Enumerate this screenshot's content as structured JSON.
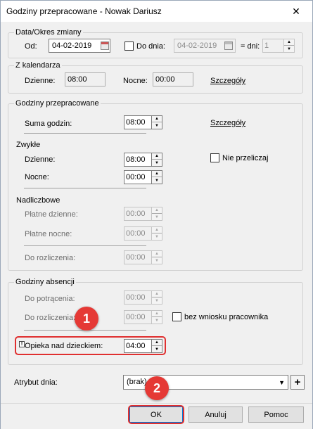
{
  "window": {
    "title": "Godziny przepracowane - Nowak Dariusz",
    "close_glyph": "✕"
  },
  "period": {
    "legend": "Data/Okres zmiany",
    "od_label": "Od:",
    "od_value": "04-02-2019",
    "do_dnia_label": "Do dnia:",
    "do_dnia_value": "04-02-2019",
    "dni_label": "= dni:",
    "dni_value": "1"
  },
  "calendar": {
    "legend": "Z kalendarza",
    "dzienne_label": "Dzienne:",
    "dzienne_value": "08:00",
    "nocne_label": "Nocne:",
    "nocne_value": "00:00",
    "details_link": "Szczegóły"
  },
  "worked": {
    "legend": "Godziny przepracowane",
    "suma_label": "Suma godzin:",
    "suma_value": "08:00",
    "details_link": "Szczegóły",
    "zwykle_label": "Zwykłe",
    "dzienne_label": "Dzienne:",
    "dzienne_value": "08:00",
    "nocne_label": "Nocne:",
    "nocne_value": "00:00",
    "nie_przeliczaj_label": "Nie przeliczaj",
    "nadliczbowe_label": "Nadliczbowe",
    "platne_dzienne_label": "Płatne dzienne:",
    "platne_dzienne_value": "00:00",
    "platne_nocne_label": "Płatne nocne:",
    "platne_nocne_value": "00:00",
    "do_rozliczenia_label": "Do rozliczenia:",
    "do_rozliczenia_value": "00:00"
  },
  "absence": {
    "legend": "Godziny absencji",
    "do_potracenia_label": "Do potrącenia:",
    "do_potracenia_value": "00:00",
    "do_rozliczenia_label": "Do rozliczenia:",
    "do_rozliczenia_value": "00:00",
    "bez_wniosku_label": "bez wniosku pracownika",
    "opieka_label": "Opieka nad dzieckiem:",
    "opieka_value": "04:00",
    "warn_glyph": "!"
  },
  "attribute": {
    "label": "Atrybut dnia:",
    "value": "(brak)",
    "plus": "+"
  },
  "buttons": {
    "ok": "OK",
    "anuluj": "Anuluj",
    "pomoc": "Pomoc"
  },
  "annotations": {
    "badge1": "1",
    "badge2": "2",
    "color": "#e53935"
  }
}
